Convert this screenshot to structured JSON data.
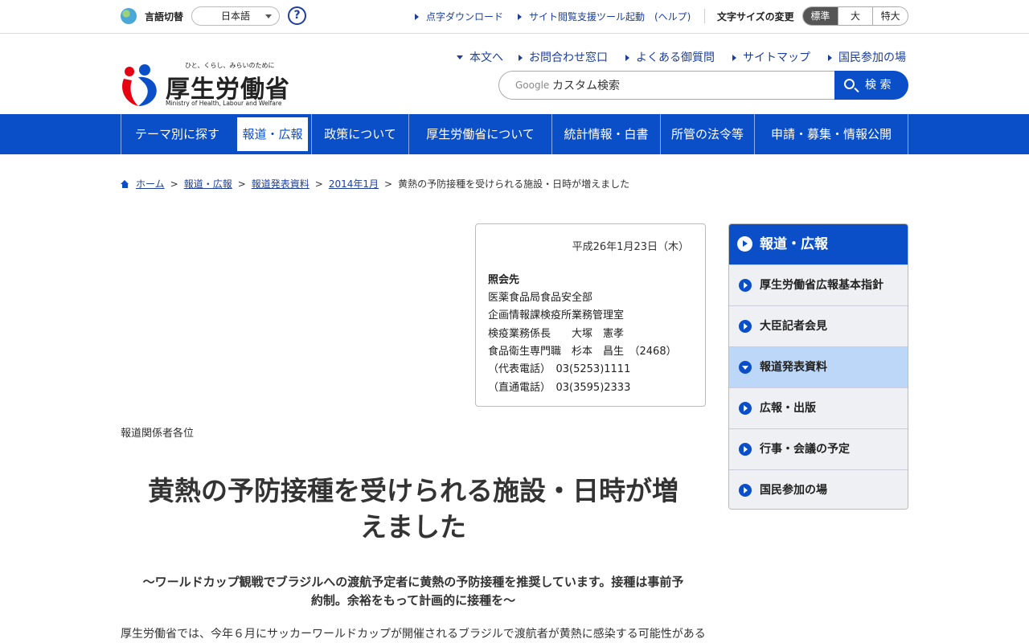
{
  "utility": {
    "lang_label": "言語切替",
    "lang_value": "日本語",
    "help": "?",
    "links": [
      "点字ダウンロード",
      "サイト閲覧支援ツール起動　(ヘルプ)"
    ],
    "font_size_label": "文字サイズの変更",
    "font_sizes": [
      "標準",
      "大",
      "特大"
    ]
  },
  "logo": {
    "tagline": "ひと、くらし、みらいのために",
    "name": "厚生労働省",
    "sub": "Ministry of Health, Labour and Welfare"
  },
  "header": {
    "links": [
      "本文へ",
      "お問合わせ窓口",
      "よくある御質問",
      "サイトマップ",
      "国民参加の場"
    ],
    "search_brand": "Google",
    "search_placeholder": "カスタム検索",
    "search_button": "検 索"
  },
  "gnav": [
    "テーマ別に探す",
    "報道・広報",
    "政策について",
    "厚生労働省について",
    "統計情報・白書",
    "所管の法令等",
    "申請・募集・情報公開"
  ],
  "breadcrumb": {
    "items": [
      "ホーム",
      "報道・広報",
      "報道発表資料",
      "2014年1月"
    ],
    "current": "黄熱の予防接種を受けられる施設・日時が増えました"
  },
  "contact": {
    "date": "平成26年1月23日（木）",
    "heading": "照会先",
    "lines": [
      "医薬食品局食品安全部",
      "企画情報課検疫所業務管理室",
      "検疫業務係長　　大塚　憲孝",
      "食品衛生専門職　杉本　昌生　（2468）",
      "（代表電話）　03(5253)1111",
      "（直通電話）　03(3595)2333"
    ]
  },
  "article": {
    "audience": "報道関係者各位",
    "title_line1": "黄熱の予防接種を受けられる施設・日時が増",
    "title_line2": "えました",
    "subtitle_line1": "～ワールドカップ観戦でブラジルへの渡航予定者に黄熱の予防接種を推奨しています。接種は事前予",
    "subtitle_line2": "約制。余裕をもって計画的に接種を～",
    "lead": "厚生労働省では、今年６月にサッカーワールドカップが開催されるブラジルで渡航者が黄熱に感染する可能性がある"
  },
  "side": {
    "heading": "報道・広報",
    "items": [
      "厚生労働省広報基本指針",
      "大臣記者会見",
      "報道発表資料",
      "広報・出版",
      "行事・会議の予定",
      "国民参加の場"
    ]
  },
  "colors": {
    "brand_blue": "#0b4fc8",
    "current_item": "#bcd7f7"
  }
}
